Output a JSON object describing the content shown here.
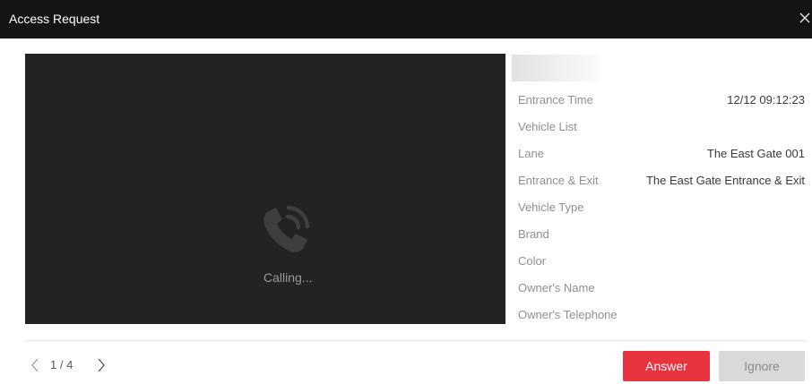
{
  "window": {
    "title": "Access Request",
    "close_icon": "close-icon"
  },
  "video": {
    "status_text": "Calling...",
    "icon": "phone-ringing-icon"
  },
  "info": {
    "rows": [
      {
        "label": "Entrance Time",
        "value": "12/12 09:12:23"
      },
      {
        "label": "Vehicle List",
        "value": ""
      },
      {
        "label": "Lane",
        "value": "The East Gate 001"
      },
      {
        "label": "Entrance & Exit",
        "value": "The East Gate Entrance & Exit"
      },
      {
        "label": "Vehicle Type",
        "value": ""
      },
      {
        "label": "Brand",
        "value": ""
      },
      {
        "label": "Color",
        "value": ""
      },
      {
        "label": "Owner's Name",
        "value": ""
      },
      {
        "label": "Owner's Telephone",
        "value": ""
      }
    ]
  },
  "pager": {
    "text": "1 / 4",
    "prev_icon": "chevron-left-icon",
    "next_icon": "chevron-right-icon"
  },
  "actions": {
    "answer_label": "Answer",
    "ignore_label": "Ignore"
  },
  "colors": {
    "titlebar": "#141414",
    "video_background": "#232323",
    "answer_button": "#e8343f",
    "ignore_button": "#d9d9d9"
  }
}
